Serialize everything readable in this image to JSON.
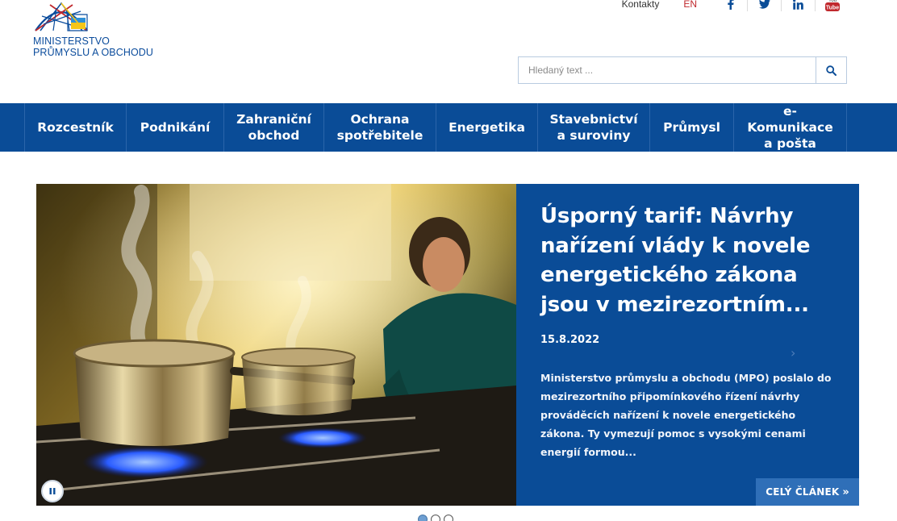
{
  "header": {
    "logo": {
      "line1": "Ministerstvo",
      "line2": "Průmyslu a obchodu"
    },
    "top_links": {
      "contacts": "Kontakty",
      "language": "EN"
    },
    "social": [
      {
        "name": "facebook-icon",
        "color": "#0a4c97"
      },
      {
        "name": "twitter-icon",
        "color": "#0a4c97"
      },
      {
        "name": "linkedin-icon",
        "color": "#0a4c97"
      },
      {
        "name": "youtube-icon",
        "label": "You Tube",
        "color": "#c0282d"
      }
    ],
    "search": {
      "placeholder": "Hledaný text ..."
    }
  },
  "nav": {
    "items": [
      {
        "line1": "Rozcestník",
        "line2": ""
      },
      {
        "line1": "Podnikání",
        "line2": ""
      },
      {
        "line1": "Zahraniční",
        "line2": "obchod"
      },
      {
        "line1": "Ochrana",
        "line2": "spotřebitele"
      },
      {
        "line1": "Energetika",
        "line2": ""
      },
      {
        "line1": "Stavebnictví",
        "line2": "a suroviny"
      },
      {
        "line1": "Průmysl",
        "line2": ""
      },
      {
        "line1": "e-Komunikace",
        "line2": "a pošta"
      }
    ]
  },
  "slider": {
    "title": "Úsporný tarif: Návrhy nařízení vlády k novele energetického zákona jsou v mezirezortním...",
    "date": "15.8.2022",
    "text": "Ministerstvo průmyslu a obchodu (MPO) poslalo do mezirezortního připomínkového řízení návrhy prováděcích nařízení k novele energetického zákona. Ty vymezují pomoc s vysokými cenami energií formou...",
    "read_more": "CELÝ ČLÁNEK",
    "read_more_icon": "double-chevron-right-icon",
    "next_icon": "chevron-right-icon",
    "pause_icon": "pause-icon",
    "dots": {
      "count": 3,
      "active": 0
    }
  },
  "colors": {
    "brand_blue": "#0a4c97",
    "accent_red": "#c0282d",
    "button_blue": "#2f6fb8"
  }
}
